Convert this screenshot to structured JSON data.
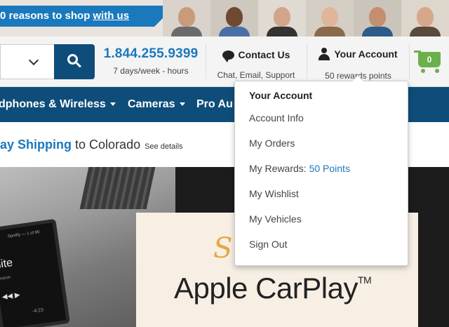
{
  "banner": {
    "text": "0 reasons to shop",
    "link": "with us",
    "ribbon_color": "#1a79bd"
  },
  "search": {
    "category_icon": "chevron-down-icon",
    "button_icon": "search-icon",
    "button_color": "#0e4d79"
  },
  "phone": {
    "number": "1.844.255.9399",
    "hours": "7 days/week - hours"
  },
  "contact": {
    "label": "Contact Us",
    "sub": "Chat, Email, Support",
    "icon": "chat-bubble-icon"
  },
  "account": {
    "label": "Your Account",
    "sub": "50 rewards points",
    "icon": "user-icon"
  },
  "cart": {
    "count": "0",
    "icon": "cart-icon",
    "color": "#6ab04c"
  },
  "nav": {
    "items": [
      {
        "label": "dphones & Wireless"
      },
      {
        "label": "Cameras"
      },
      {
        "label": "Pro Au"
      }
    ]
  },
  "shipping": {
    "strong": "ay Shipping",
    "rest": "to Colorado",
    "details": "See details"
  },
  "hero": {
    "screen_app": "Spotify — 1 of 80",
    "screen_title": "hite",
    "screen_sub": "eason",
    "screen_time": "-4:23",
    "script_text": "Supp",
    "headline": "Apple CarPlay",
    "tm": "TM"
  },
  "dropdown": {
    "title": "Your Account",
    "items": [
      {
        "label": "Account Info"
      },
      {
        "label": "My Orders"
      },
      {
        "label": "My Rewards:",
        "extra": "50 Points"
      },
      {
        "label": "My Wishlist"
      },
      {
        "label": "My Vehicles"
      },
      {
        "label": "Sign Out"
      }
    ]
  }
}
